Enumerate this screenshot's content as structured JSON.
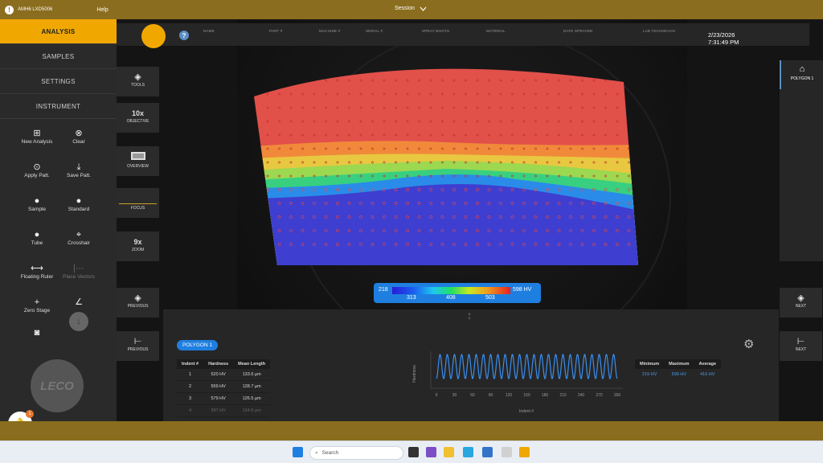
{
  "topbar": {
    "model": "AMH6 LXD5006",
    "help": "Help",
    "session": "Session"
  },
  "nav": {
    "tabs": [
      "ANALYSIS",
      "SAMPLES",
      "SETTINGS",
      "INSTRUMENT"
    ]
  },
  "tools": {
    "new_analysis": "New Analysis",
    "clear": "Clear",
    "apply_patt": "Apply Patt.",
    "save_patt": "Save Patt.",
    "sample": "Sample",
    "standard": "Standard",
    "tube": "Tube",
    "crosshair": "Crosshair",
    "floating_ruler": "Floating Ruler",
    "place_vectors": "Place Vectors",
    "zero_stage": "Zero Stage"
  },
  "logo": "LECO",
  "notifications": {
    "count": "1"
  },
  "header": {
    "columns": [
      "NAME",
      "PART #",
      "MACHINE #",
      "SERIAL #",
      "SPRAY BOOTH",
      "MATERIAL",
      "DATE SPRAYED",
      "LAB TECHNICIAN"
    ],
    "date": "2/23/2026",
    "time": "7:31:49 PM"
  },
  "left_controls": {
    "tools": "TOOLS",
    "objective_value": "10x",
    "objective": "OBJECTIVE",
    "overview": "OVERVIEW",
    "focus": "FOCUS",
    "zoom_value": "9x",
    "zoom": "ZOOM",
    "previous": "PREVIOUS",
    "previous2": "PREVIOUS"
  },
  "right_controls": {
    "polygon": "POLYGON 1",
    "next": "NEXT",
    "next2": "NEXT"
  },
  "legend": {
    "min": "218",
    "max": "598 HV",
    "ticks": [
      "313",
      "408",
      "503"
    ]
  },
  "results": {
    "polygon_label": "POLYGON 1",
    "table_headers": [
      "Indent #",
      "Hardness",
      "Mean Length"
    ],
    "rows": [
      [
        "1",
        "520 HV",
        "133.6 µm"
      ],
      [
        "2",
        "559 HV",
        "128.7 µm"
      ],
      [
        "3",
        "579 HV",
        "126.5 µm"
      ],
      [
        "4",
        "597 HV",
        "124.6 µm"
      ]
    ],
    "stats_headers": [
      "Minimum",
      "Maximum",
      "Average"
    ],
    "stats_values": [
      "219 HV",
      "599 HV",
      "416 HV"
    ]
  },
  "chart_data": {
    "type": "line",
    "xlabel": "Indent #",
    "ylabel": "Hardness",
    "x_ticks": [
      "0",
      "30",
      "60",
      "90",
      "120",
      "150",
      "180",
      "210",
      "240",
      "270",
      "300"
    ],
    "xlim": [
      0,
      300
    ],
    "ylim": [
      218,
      598
    ],
    "cycles": 25
  },
  "taskbar": {
    "search": "Search"
  },
  "colors": {
    "accent": "#f0a800",
    "gold": "#8a6d1e",
    "blue": "#1f7fe0"
  }
}
